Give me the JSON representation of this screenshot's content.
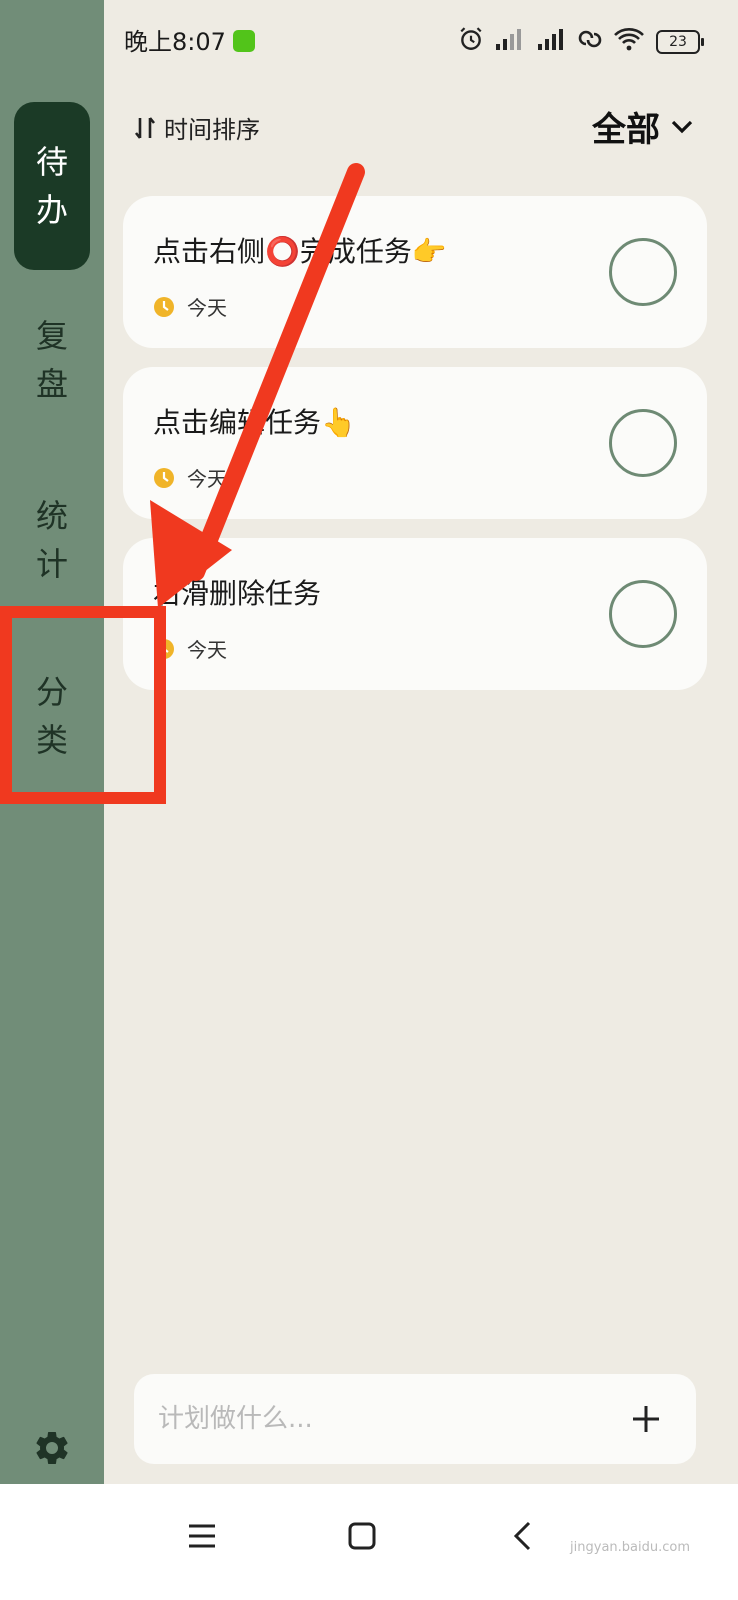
{
  "status_bar": {
    "time": "晚上8:07",
    "battery": "23"
  },
  "sidebar": {
    "items": [
      {
        "label_1": "待",
        "label_2": "办",
        "active": true
      },
      {
        "label_1": "复",
        "label_2": "盘",
        "active": false
      },
      {
        "label_1": "统",
        "label_2": "计",
        "active": false
      },
      {
        "label_1": "分",
        "label_2": "类",
        "active": false
      }
    ],
    "settings_icon": "gear-icon"
  },
  "header": {
    "sort_label": "时间排序",
    "filter_label": "全部"
  },
  "tasks": [
    {
      "title": "点击右侧⭕完成任务👉",
      "date": "今天"
    },
    {
      "title": "点击编辑任务👆",
      "date": "今天"
    },
    {
      "title": "右滑删除任务",
      "date": "今天"
    }
  ],
  "input": {
    "placeholder": "计划做什么..."
  },
  "watermark": "jingyan.baidu.com",
  "colors": {
    "sidebar": "#718d78",
    "active": "#1b3a26",
    "background": "#eeebe3",
    "annotation": "#f0391f"
  }
}
